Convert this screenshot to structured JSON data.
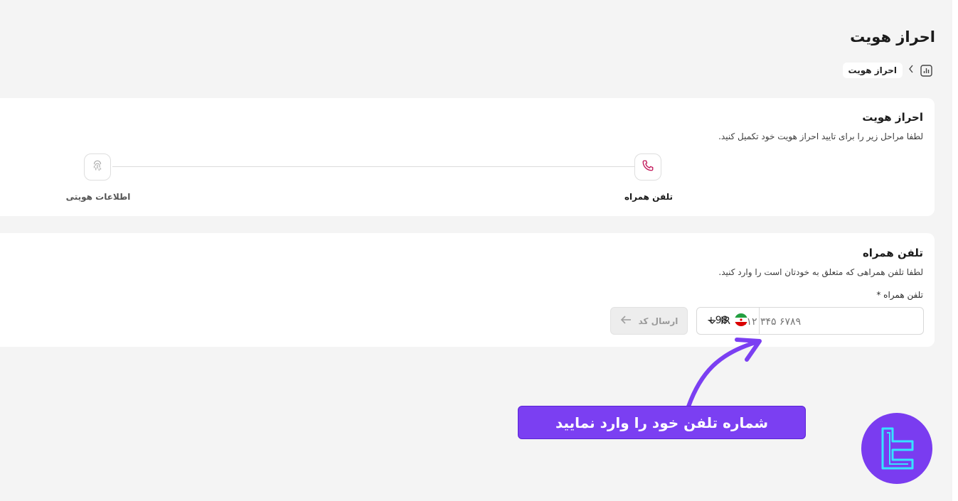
{
  "page": {
    "title": "احراز هویت",
    "breadcrumb": {
      "home_icon": "chart-icon",
      "current": "احراز هویت"
    }
  },
  "verification_card": {
    "title": "احراز هویت",
    "subtitle": "لطفا مراحل زیر را برای تایید احراز هویت خود تکمیل کنید.",
    "steps": [
      {
        "label": "تلفن همراه",
        "icon": "phone-icon",
        "active": true
      },
      {
        "label": "اطلاعات هویتی",
        "icon": "fingerprint-icon",
        "active": false
      }
    ]
  },
  "phone_card": {
    "title": "تلفن همراه",
    "subtitle": "لطفا تلفن همراهی که متعلق به خودتان است را وارد کنید.",
    "field_label": "تلفن همراه *",
    "country_code": "IR",
    "country_flag": "iran-flag-icon",
    "dial_code": "+98",
    "placeholder": "۹۱۲ ۳۴۵ ۶۷۸۹",
    "send_button": "ارسال کد"
  },
  "annotation": {
    "text": "شماره تلفن خود را وارد نمایید",
    "color": "#7b3ff2"
  },
  "colors": {
    "accent": "#c2185b",
    "background": "#f4f4f4",
    "card": "#ffffff",
    "logo": "#7a3cf0"
  }
}
